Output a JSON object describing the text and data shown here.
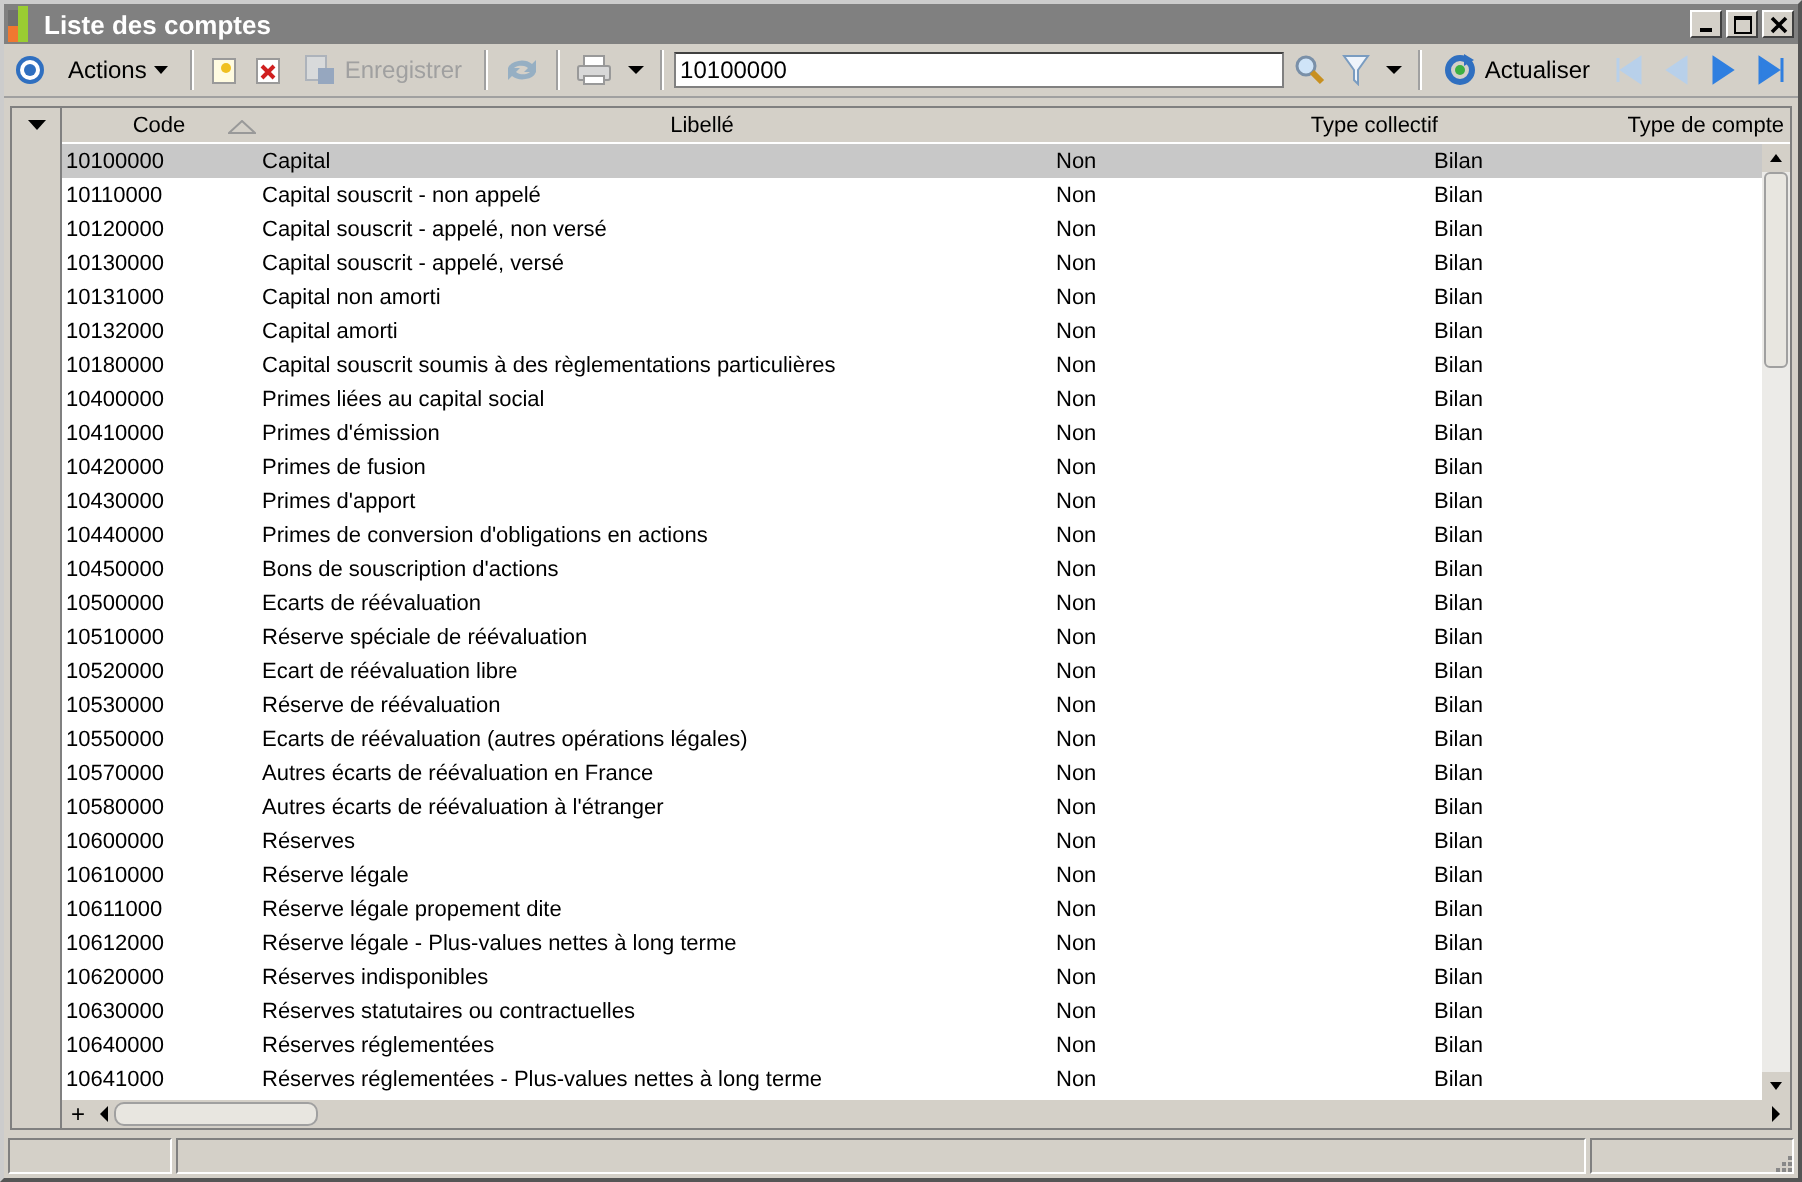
{
  "window": {
    "title": "Liste des comptes"
  },
  "toolbar": {
    "actions": "Actions",
    "save": {
      "label": "Enregistrer",
      "disabled": true
    },
    "refresh_disabled": true,
    "search": {
      "value": "10100000"
    },
    "refresh": "Actualiser",
    "nav": [
      {
        "disabled": true
      },
      {
        "disabled": true
      },
      {
        "disabled": false
      },
      {
        "disabled": false
      }
    ]
  },
  "table": {
    "columns": [
      "Code",
      "Libellé",
      "Type collectif",
      "Type de compte"
    ],
    "rows": [
      {
        "code": "10100000",
        "label": "Capital",
        "collectif": "Non",
        "type": "Bilan",
        "selected": true
      },
      {
        "code": "10110000",
        "label": "Capital souscrit - non appelé",
        "collectif": "Non",
        "type": "Bilan",
        "selected": false
      },
      {
        "code": "10120000",
        "label": "Capital souscrit - appelé, non versé",
        "collectif": "Non",
        "type": "Bilan",
        "selected": false
      },
      {
        "code": "10130000",
        "label": "Capital souscrit - appelé, versé",
        "collectif": "Non",
        "type": "Bilan",
        "selected": false
      },
      {
        "code": "10131000",
        "label": "Capital non amorti",
        "collectif": "Non",
        "type": "Bilan",
        "selected": false
      },
      {
        "code": "10132000",
        "label": "Capital amorti",
        "collectif": "Non",
        "type": "Bilan",
        "selected": false
      },
      {
        "code": "10180000",
        "label": "Capital souscrit soumis à des règlementations particulières",
        "collectif": "Non",
        "type": "Bilan",
        "selected": false
      },
      {
        "code": "10400000",
        "label": "Primes liées au capital social",
        "collectif": "Non",
        "type": "Bilan",
        "selected": false
      },
      {
        "code": "10410000",
        "label": "Primes d'émission",
        "collectif": "Non",
        "type": "Bilan",
        "selected": false
      },
      {
        "code": "10420000",
        "label": "Primes de fusion",
        "collectif": "Non",
        "type": "Bilan",
        "selected": false
      },
      {
        "code": "10430000",
        "label": "Primes d'apport",
        "collectif": "Non",
        "type": "Bilan",
        "selected": false
      },
      {
        "code": "10440000",
        "label": "Primes de conversion d'obligations en actions",
        "collectif": "Non",
        "type": "Bilan",
        "selected": false
      },
      {
        "code": "10450000",
        "label": "Bons de souscription d'actions",
        "collectif": "Non",
        "type": "Bilan",
        "selected": false
      },
      {
        "code": "10500000",
        "label": "Ecarts de réévaluation",
        "collectif": "Non",
        "type": "Bilan",
        "selected": false
      },
      {
        "code": "10510000",
        "label": "Réserve spéciale de réévaluation",
        "collectif": "Non",
        "type": "Bilan",
        "selected": false
      },
      {
        "code": "10520000",
        "label": "Ecart de réévaluation libre",
        "collectif": "Non",
        "type": "Bilan",
        "selected": false
      },
      {
        "code": "10530000",
        "label": "Réserve de réévaluation",
        "collectif": "Non",
        "type": "Bilan",
        "selected": false
      },
      {
        "code": "10550000",
        "label": "Ecarts de réévaluation (autres opérations légales)",
        "collectif": "Non",
        "type": "Bilan",
        "selected": false
      },
      {
        "code": "10570000",
        "label": "Autres écarts de réévaluation en France",
        "collectif": "Non",
        "type": "Bilan",
        "selected": false
      },
      {
        "code": "10580000",
        "label": "Autres écarts de réévaluation à l'étranger",
        "collectif": "Non",
        "type": "Bilan",
        "selected": false
      },
      {
        "code": "10600000",
        "label": "Réserves",
        "collectif": "Non",
        "type": "Bilan",
        "selected": false
      },
      {
        "code": "10610000",
        "label": "Réserve légale",
        "collectif": "Non",
        "type": "Bilan",
        "selected": false
      },
      {
        "code": "10611000",
        "label": "Réserve légale propement dite",
        "collectif": "Non",
        "type": "Bilan",
        "selected": false
      },
      {
        "code": "10612000",
        "label": "Réserve légale - Plus-values nettes à long terme",
        "collectif": "Non",
        "type": "Bilan",
        "selected": false
      },
      {
        "code": "10620000",
        "label": "Réserves indisponibles",
        "collectif": "Non",
        "type": "Bilan",
        "selected": false
      },
      {
        "code": "10630000",
        "label": "Réserves statutaires ou contractuelles",
        "collectif": "Non",
        "type": "Bilan",
        "selected": false
      },
      {
        "code": "10640000",
        "label": "Réserves réglementées",
        "collectif": "Non",
        "type": "Bilan",
        "selected": false
      },
      {
        "code": "10641000",
        "label": "Réserves réglementées - Plus-values nettes à long terme",
        "collectif": "Non",
        "type": "Bilan",
        "selected": false
      }
    ],
    "add_button": "+"
  }
}
